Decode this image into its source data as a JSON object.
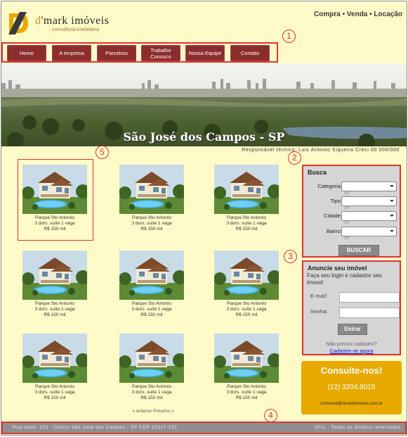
{
  "logo": {
    "name_prefix": "d",
    "name_rest": "'mark imóveis",
    "subtitle": "consultoria imobiliária"
  },
  "top_links": "Compra • Venda • Locação",
  "nav": [
    {
      "label": "Home"
    },
    {
      "label": "A empresa"
    },
    {
      "label": "Parceiros"
    },
    {
      "label": "Trabalhe Conosco"
    },
    {
      "label": "Nossa Equipe"
    },
    {
      "label": "Contato"
    }
  ],
  "callouts": [
    "1",
    "2",
    "3",
    "4",
    "5"
  ],
  "banner": {
    "title": "São José dos Campos - SP"
  },
  "responsavel": "Responsável técnico: Luis Antonio Siqueira Creci 00 000/000",
  "listings": [
    {
      "name": "Parque Sto Antonio",
      "desc": "3 dors. suíte 1 vaga",
      "price": "R$ 150 mil"
    },
    {
      "name": "Parque Sto Antonio",
      "desc": "3 dors. suíte 1 vaga",
      "price": "R$ 150 mil"
    },
    {
      "name": "Parque Sto Antonio",
      "desc": "3 dors. suíte 1 vaga",
      "price": "R$ 150 mil"
    },
    {
      "name": "Parque Sto Antonio",
      "desc": "3 dors. suíte 1 vaga",
      "price": "R$ 150 mil"
    },
    {
      "name": "Parque Sto Antonio",
      "desc": "3 dors. suíte 1 vaga",
      "price": "R$ 150 mil"
    },
    {
      "name": "Parque Sto Antonio",
      "desc": "3 dors. suíte 1 vaga",
      "price": "R$ 150 mil"
    },
    {
      "name": "Parque Sto Antonio",
      "desc": "3 dors. suíte 1 vaga",
      "price": "R$ 150 mil"
    },
    {
      "name": "Parque Sto Antonio",
      "desc": "3 dors. suíte 1 vaga",
      "price": "R$ 150 mil"
    },
    {
      "name": "Parque Sto Antonio",
      "desc": "3 dors. suíte 1 vaga",
      "price": "R$ 150 mil"
    }
  ],
  "pagination": "« Anterior Próximo »",
  "busca": {
    "title": "Busca",
    "fields": [
      {
        "label": "Categoria:",
        "value": "",
        "ghost": "be"
      },
      {
        "label": "Tipo:",
        "value": "",
        "ghost": "be"
      },
      {
        "label": "Cidade:",
        "value": "",
        "ghost": "be"
      },
      {
        "label": "Bairro:",
        "value": "",
        "ghost": "be"
      }
    ],
    "button": "BUSCAR"
  },
  "anuncie": {
    "title": "Anuncie seu imóvel",
    "desc": "Faça seu login e cadastre seu imovel",
    "email_label": "E-mail:",
    "senha_label": "Senha:",
    "email_value": "",
    "senha_value": "",
    "button": "Entrar",
    "no_account": "Não possui cadastro?",
    "signup": "Cadastre-se agora"
  },
  "consulte": {
    "title": "Consulte-nos!",
    "phone": "(12) 3204.8015",
    "email": "comercial@dmarkimoveis.com.br"
  },
  "footer": {
    "address": "Rua teste, 123 - Centro São José dos Campos - SP CEP 12317-123",
    "rights": "2011 - Todos os direitos reservados"
  },
  "colors": {
    "background": "#fffbc8",
    "nav": "#8b2d2d",
    "accent": "#e8a900",
    "highlight": "#dd3333",
    "panel": "#d6d5d5"
  }
}
